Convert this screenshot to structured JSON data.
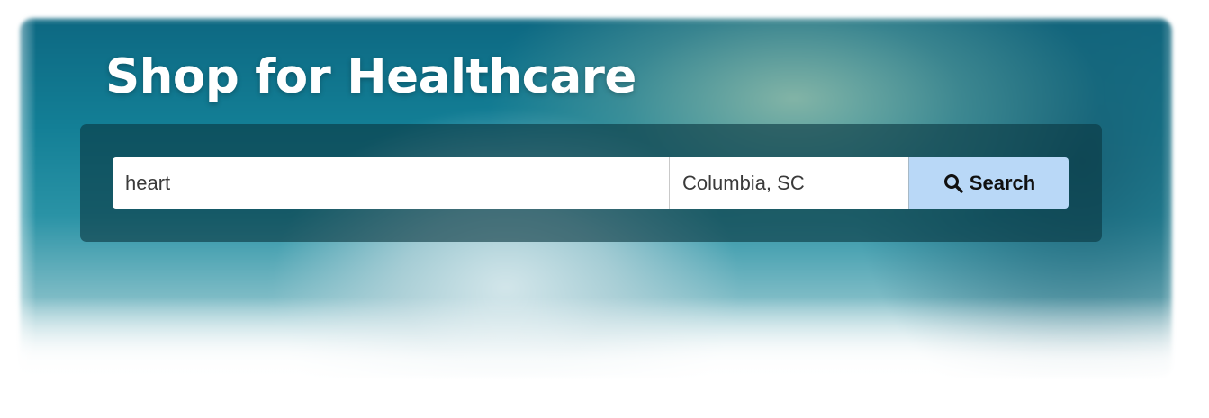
{
  "hero": {
    "title": "Shop for Healthcare"
  },
  "search": {
    "query_value": "heart",
    "location_value": "Columbia, SC",
    "button_label": "Search",
    "button_icon": "search-icon"
  },
  "colors": {
    "button_bg": "#b9d8f7",
    "panel_bg": "#0a3741",
    "hero_teal": "#137f96",
    "title_text": "#ffffff"
  }
}
